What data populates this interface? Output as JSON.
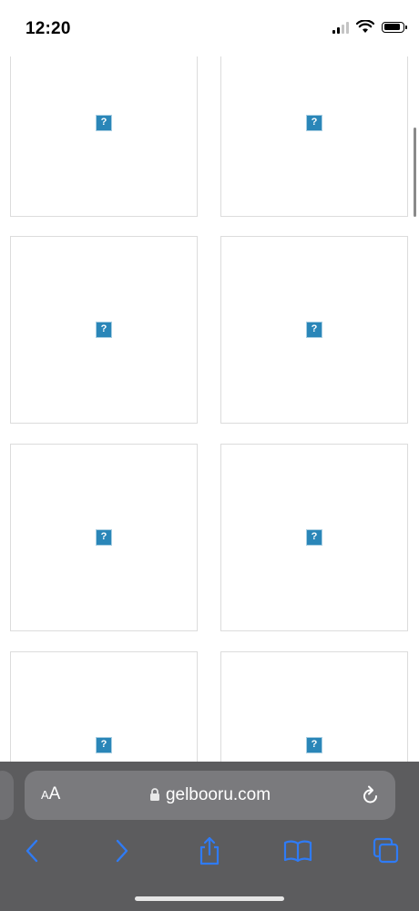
{
  "status_bar": {
    "time": "12:20",
    "icons": [
      "signal-icon",
      "wifi-icon",
      "battery-icon"
    ]
  },
  "gallery": {
    "thumbnails": [
      {
        "icon": "broken-image-icon",
        "glyph": "?"
      },
      {
        "icon": "broken-image-icon",
        "glyph": "?"
      },
      {
        "icon": "broken-image-icon",
        "glyph": "?"
      },
      {
        "icon": "broken-image-icon",
        "glyph": "?"
      },
      {
        "icon": "broken-image-icon",
        "glyph": "?"
      },
      {
        "icon": "broken-image-icon",
        "glyph": "?"
      },
      {
        "icon": "broken-image-icon",
        "glyph": "?"
      },
      {
        "icon": "broken-image-icon",
        "glyph": "?"
      }
    ]
  },
  "safari": {
    "text_size_small": "A",
    "text_size_large": "A",
    "url": "gelbooru.com",
    "toolbar": [
      "back-icon",
      "forward-icon",
      "share-icon",
      "bookmarks-icon",
      "tabs-icon"
    ]
  },
  "colors": {
    "accent": "#2a86b8",
    "toolbar_icon": "#2f7bf5",
    "safari_bar": "#5c5c5e",
    "address_pill": "#7a7a7d"
  }
}
